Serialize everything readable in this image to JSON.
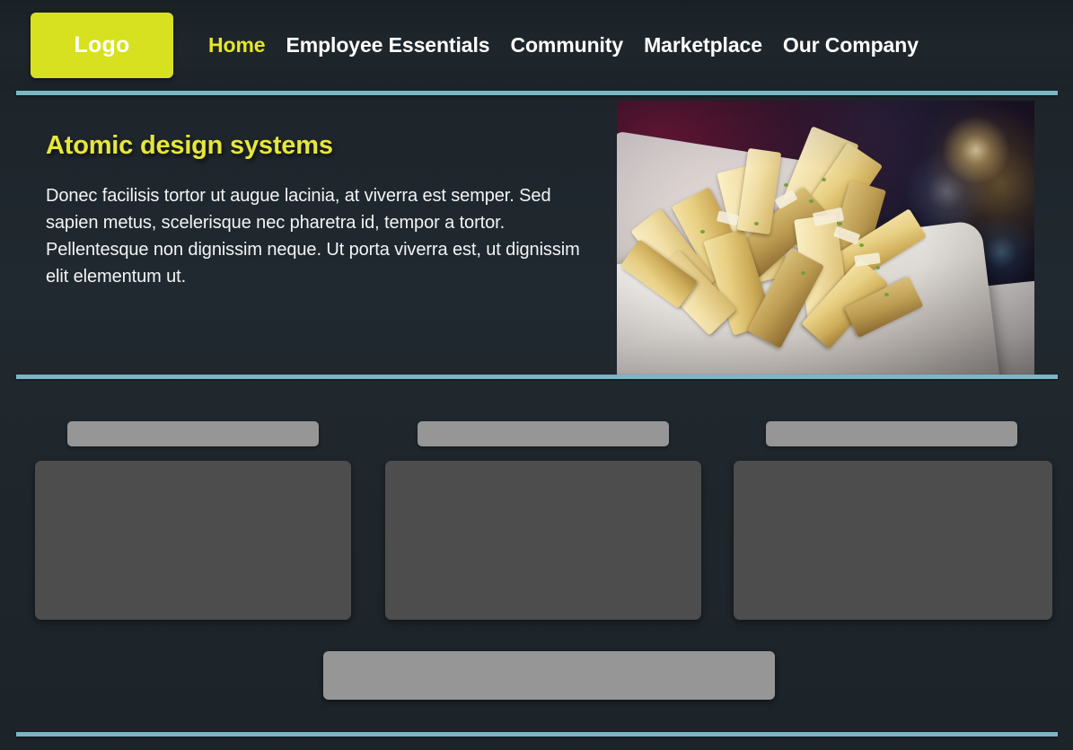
{
  "header": {
    "logo_label": "Logo",
    "nav_items": [
      {
        "label": "Home",
        "active": true
      },
      {
        "label": "Employee Essentials",
        "active": false
      },
      {
        "label": "Community",
        "active": false
      },
      {
        "label": "Marketplace",
        "active": false
      },
      {
        "label": "Our Company",
        "active": false
      }
    ]
  },
  "hero": {
    "title": "Atomic design systems",
    "body": "Donec facilisis tortor ut augue lacinia, at viverra est semper. Sed sapien metus, scelerisque nec pharetra id, tempor a tortor. Pellentesque non dignissim neque. Ut porta viverra est, ut dignissim elit elementum ut.",
    "image_alt": "Basket of garlic parmesan french fries on a white plate in a dark restaurant"
  },
  "content": {
    "card_groups": [
      {
        "bar_label": "",
        "card_label": ""
      },
      {
        "bar_label": "",
        "card_label": ""
      },
      {
        "bar_label": "",
        "card_label": ""
      }
    ],
    "wide_bar_label": ""
  },
  "colors": {
    "page_background": "#1e252b",
    "header_background": "#1b2329",
    "accent_yellow": "#e6e626",
    "logo_yellow": "#d7e11f",
    "heading_yellow": "#e7e63c",
    "divider_teal": "#79b7c4",
    "placeholder_bar_gray": "#969696",
    "placeholder_card_gray": "#4d4d4d",
    "nav_text": "#ffffff",
    "body_text": "#f2f4f5"
  }
}
